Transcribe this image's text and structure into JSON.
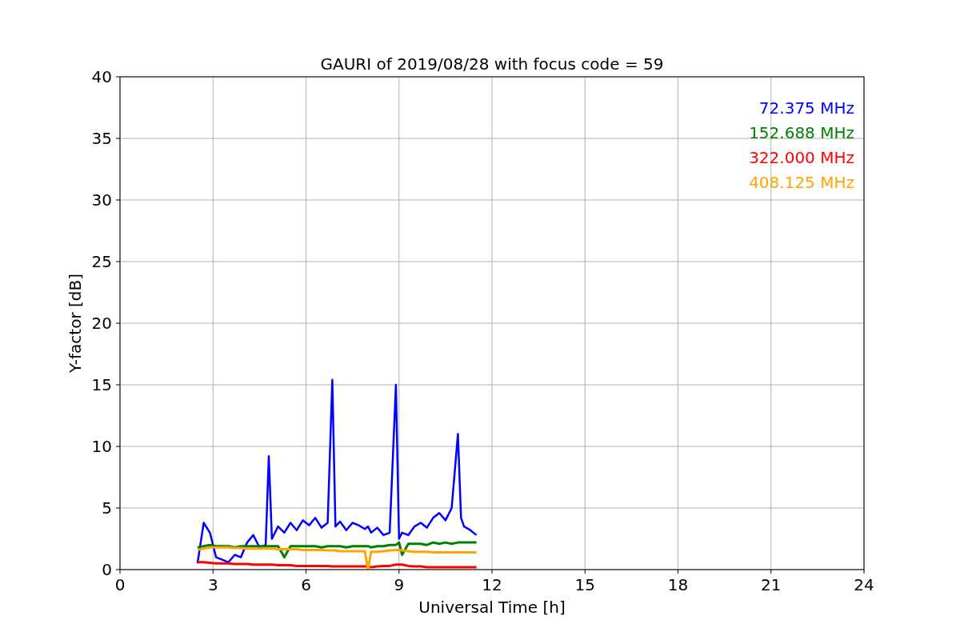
{
  "figure": {
    "chart_data": {
      "type": "line",
      "title": "GAURI of 2019/08/28 with focus code = 59",
      "xlabel": "Universal Time [h]",
      "ylabel": "Y-factor [dB]",
      "x": [
        2.5,
        2.7,
        2.9,
        3.1,
        3.3,
        3.5,
        3.7,
        3.9,
        4.1,
        4.3,
        4.5,
        4.7,
        4.8,
        4.9,
        5.1,
        5.3,
        5.5,
        5.7,
        5.9,
        6.1,
        6.3,
        6.5,
        6.7,
        6.85,
        6.95,
        7.1,
        7.3,
        7.5,
        7.7,
        7.9,
        8.0,
        8.1,
        8.3,
        8.5,
        8.7,
        8.9,
        9.0,
        9.1,
        9.3,
        9.5,
        9.7,
        9.9,
        10.1,
        10.3,
        10.5,
        10.7,
        10.9,
        11.0,
        11.1,
        11.3,
        11.5
      ],
      "series": [
        {
          "name": "72.375 MHz",
          "color": "#0000ff",
          "values": [
            0.5,
            3.8,
            3.0,
            1.0,
            0.8,
            0.6,
            1.2,
            1.0,
            2.2,
            2.8,
            1.8,
            2.0,
            9.2,
            2.5,
            3.5,
            3.0,
            3.8,
            3.2,
            4.0,
            3.6,
            4.2,
            3.4,
            3.8,
            15.4,
            3.5,
            3.9,
            3.2,
            3.8,
            3.6,
            3.3,
            3.5,
            3.0,
            3.4,
            2.8,
            3.0,
            15.0,
            2.5,
            3.0,
            2.8,
            3.5,
            3.8,
            3.4,
            4.2,
            4.6,
            4.0,
            5.0,
            11.0,
            4.2,
            3.5,
            3.2,
            2.8
          ]
        },
        {
          "name": "152.688 MHz",
          "color": "#008000",
          "values": [
            1.8,
            1.9,
            2.0,
            1.9,
            1.9,
            1.9,
            1.8,
            1.9,
            1.9,
            1.9,
            1.9,
            1.9,
            1.9,
            1.9,
            1.9,
            1.0,
            1.9,
            1.9,
            1.9,
            1.9,
            1.9,
            1.8,
            1.9,
            1.9,
            1.9,
            1.9,
            1.8,
            1.9,
            1.9,
            1.9,
            1.9,
            1.8,
            1.9,
            1.9,
            2.0,
            2.0,
            2.2,
            1.2,
            2.1,
            2.1,
            2.1,
            2.0,
            2.2,
            2.1,
            2.2,
            2.1,
            2.2,
            2.2,
            2.2,
            2.2,
            2.2
          ]
        },
        {
          "name": "322.000 MHz",
          "color": "#ff0000",
          "values": [
            0.6,
            0.6,
            0.55,
            0.5,
            0.5,
            0.5,
            0.45,
            0.45,
            0.45,
            0.4,
            0.4,
            0.4,
            0.4,
            0.4,
            0.35,
            0.35,
            0.35,
            0.3,
            0.3,
            0.3,
            0.3,
            0.3,
            0.3,
            0.25,
            0.25,
            0.25,
            0.25,
            0.25,
            0.25,
            0.25,
            0.25,
            0.2,
            0.25,
            0.3,
            0.3,
            0.4,
            0.4,
            0.4,
            0.3,
            0.25,
            0.25,
            0.2,
            0.2,
            0.2,
            0.2,
            0.2,
            0.2,
            0.2,
            0.2,
            0.2,
            0.2
          ]
        },
        {
          "name": "408.125 MHz",
          "color": "#ffa500",
          "values": [
            1.6,
            1.7,
            1.8,
            1.8,
            1.8,
            1.8,
            1.75,
            1.75,
            1.7,
            1.7,
            1.7,
            1.7,
            1.7,
            1.7,
            1.65,
            1.65,
            1.65,
            1.65,
            1.6,
            1.6,
            1.6,
            1.6,
            1.55,
            1.55,
            1.55,
            1.5,
            1.5,
            1.5,
            1.5,
            1.5,
            0.0,
            1.45,
            1.45,
            1.5,
            1.55,
            1.6,
            1.6,
            1.55,
            1.5,
            1.45,
            1.45,
            1.45,
            1.4,
            1.4,
            1.4,
            1.4,
            1.4,
            1.4,
            1.4,
            1.4,
            1.4
          ]
        }
      ],
      "grid": true,
      "xlim": [
        0,
        24
      ],
      "ylim": [
        0,
        40
      ],
      "xticks": [
        0,
        3,
        6,
        9,
        12,
        15,
        18,
        21,
        24
      ],
      "yticks": [
        0,
        5,
        10,
        15,
        20,
        25,
        30,
        35,
        40
      ]
    }
  }
}
